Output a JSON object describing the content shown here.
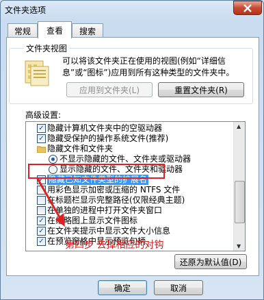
{
  "window": {
    "title": "文件夹选项"
  },
  "tabs": [
    {
      "label": "常规",
      "active": false
    },
    {
      "label": "查看",
      "active": true
    },
    {
      "label": "搜索",
      "active": false
    }
  ],
  "folder_views": {
    "title": "文件夹视图",
    "description": "可以将该文件夹正在使用的视图(例如“详细信息”或“图标”)应用到所有这种类型的文件夹中。",
    "apply_button": "应用到文件夹(L)",
    "reset_button": "重置文件夹(R)"
  },
  "advanced": {
    "label": "高级设置:",
    "items": [
      {
        "kind": "checkbox",
        "checked": true,
        "indent": 1,
        "label": "隐藏计算机文件夹中的空驱动器"
      },
      {
        "kind": "checkbox",
        "checked": true,
        "indent": 1,
        "label": "隐藏受保护的操作系统文件(推荐)"
      },
      {
        "kind": "folder",
        "indent": 1,
        "label": "隐藏文件和文件夹"
      },
      {
        "kind": "radio",
        "checked": true,
        "indent": 2,
        "label": "不显示隐藏的文件、文件夹或驱动器"
      },
      {
        "kind": "radio",
        "checked": false,
        "indent": 2,
        "label": "显示隐藏的文件、文件夹和驱动器"
      },
      {
        "kind": "checkbox",
        "checked": true,
        "indent": 1,
        "label": "隐藏已知文件类型的扩展名",
        "highlighted": true
      },
      {
        "kind": "checkbox",
        "checked": false,
        "indent": 1,
        "label": "用彩色显示加密或压缩的 NTFS 文件"
      },
      {
        "kind": "checkbox",
        "checked": false,
        "indent": 1,
        "label": "在标题栏显示完整路径(仅限经典主题)"
      },
      {
        "kind": "checkbox",
        "checked": false,
        "indent": 1,
        "label": "在单独的进程中打开文件夹窗口"
      },
      {
        "kind": "checkbox",
        "checked": true,
        "indent": 1,
        "label": "在缩略图上显示文件图标"
      },
      {
        "kind": "checkbox",
        "checked": true,
        "indent": 1,
        "label": "在文件夹提示中显示文件大小信息"
      },
      {
        "kind": "checkbox",
        "checked": true,
        "indent": 1,
        "label": "在预览窗格中显示预览句柄"
      }
    ],
    "restore_button": "还原为默认值(D)"
  },
  "annotation": {
    "text": "第四步 去掉相应的对钩",
    "color": "#d71a1a"
  },
  "footer": {
    "ok": "确定",
    "cancel": "取消"
  }
}
